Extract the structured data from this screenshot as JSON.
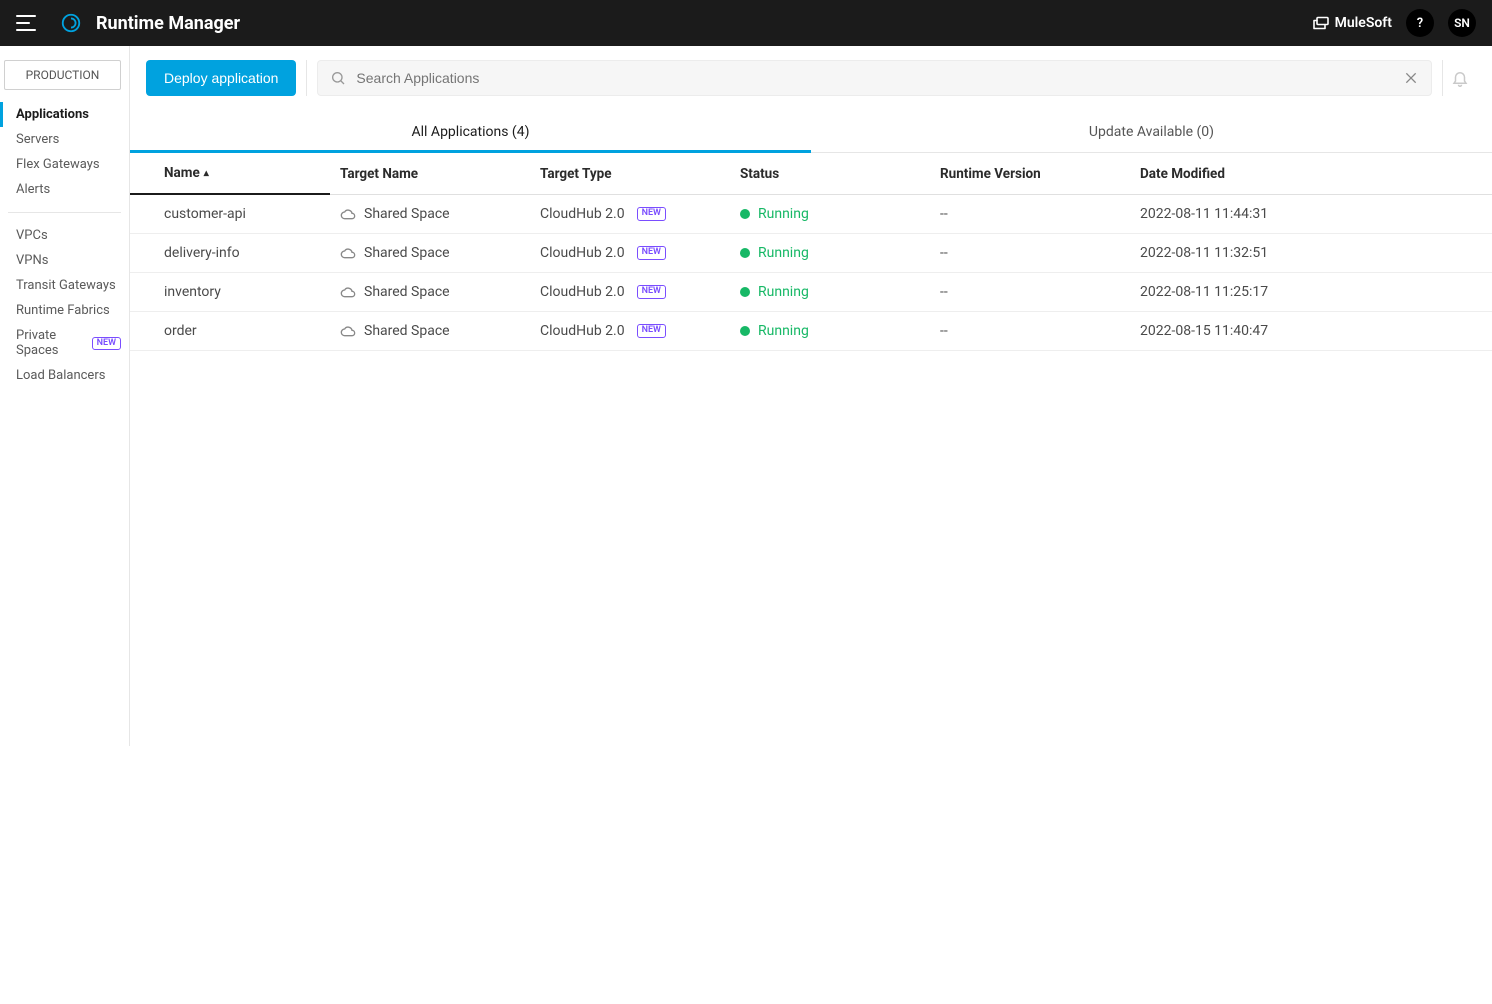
{
  "header": {
    "app_title": "Runtime Manager",
    "brand_label": "MuleSoft",
    "help_label": "?",
    "avatar_initials": "SN"
  },
  "sidebar": {
    "environment": "PRODUCTION",
    "items_top": [
      {
        "label": "Applications",
        "active": true
      },
      {
        "label": "Servers",
        "active": false
      },
      {
        "label": "Flex Gateways",
        "active": false
      },
      {
        "label": "Alerts",
        "active": false
      }
    ],
    "items_bottom": [
      {
        "label": "VPCs",
        "badge": ""
      },
      {
        "label": "VPNs",
        "badge": ""
      },
      {
        "label": "Transit Gateways",
        "badge": ""
      },
      {
        "label": "Runtime Fabrics",
        "badge": ""
      },
      {
        "label": "Private Spaces",
        "badge": "NEW"
      },
      {
        "label": "Load Balancers",
        "badge": ""
      }
    ]
  },
  "actions": {
    "deploy_label": "Deploy application",
    "search_placeholder": "Search Applications"
  },
  "tabs": {
    "all": {
      "label": "All Applications",
      "count": 4
    },
    "updates": {
      "label": "Update Available",
      "count": 0
    }
  },
  "table": {
    "columns": {
      "name": "Name",
      "target_name": "Target Name",
      "target_type": "Target Type",
      "status": "Status",
      "runtime_version": "Runtime Version",
      "date_modified": "Date Modified"
    },
    "type_badge": "NEW",
    "rows": [
      {
        "name": "customer-api",
        "target_name": "Shared Space",
        "target_type": "CloudHub 2.0",
        "status": "Running",
        "runtime_version": "--",
        "date_modified": "2022-08-11 11:44:31"
      },
      {
        "name": "delivery-info",
        "target_name": "Shared Space",
        "target_type": "CloudHub 2.0",
        "status": "Running",
        "runtime_version": "--",
        "date_modified": "2022-08-11 11:32:51"
      },
      {
        "name": "inventory",
        "target_name": "Shared Space",
        "target_type": "CloudHub 2.0",
        "status": "Running",
        "runtime_version": "--",
        "date_modified": "2022-08-11 11:25:17"
      },
      {
        "name": "order",
        "target_name": "Shared Space",
        "target_type": "CloudHub 2.0",
        "status": "Running",
        "runtime_version": "--",
        "date_modified": "2022-08-15 11:40:47"
      }
    ]
  },
  "colors": {
    "accent": "#00a2df",
    "status_running": "#17b866",
    "badge_purple": "#7a4dff"
  }
}
